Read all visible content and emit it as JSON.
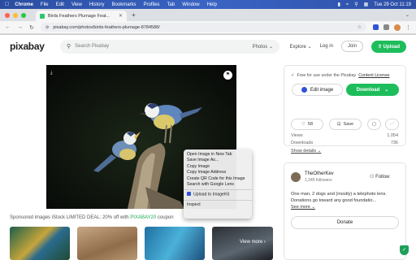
{
  "menubar": {
    "app": "Chrome",
    "items": [
      "File",
      "Edit",
      "View",
      "History",
      "Bookmarks",
      "Profiles",
      "Tab",
      "Window",
      "Help"
    ],
    "clock": "Tue 29 Oct  11:19"
  },
  "tab": {
    "title": "Birds Feathers Plumage Feat..."
  },
  "address": {
    "url": "pixabay.com/photos/birds-feathers-plumage-8784588/"
  },
  "header": {
    "logo": "pixabay",
    "search_placeholder": "Search Pixabay",
    "search_filter": "Photos",
    "explore": "Explore",
    "login": "Log in",
    "join": "Join",
    "upload": "Upload"
  },
  "context_menu": {
    "items": [
      "Open Image in New Tab",
      "Save Image As...",
      "Copy Image",
      "Copy Image Address",
      "Create QR Code for this Image",
      "Search with Google Lens"
    ],
    "extension_item": "Upload to ImageKit",
    "inspect": "Inspect"
  },
  "sponsored": {
    "text": "Sponsored images iStock LIMITED DEAL: 20% off with",
    "code": "PIXABAY20",
    "suffix": "coupon"
  },
  "thumbs": {
    "more_label": "View more"
  },
  "panel": {
    "license_prefix": "Free for use under the Pixabay",
    "license_link": "Content License",
    "edit_label": "Edit image",
    "download_label": "Download",
    "likes": "58",
    "save_label": "Save"
  },
  "stats": {
    "views_label": "Views",
    "views_value": "1,054",
    "downloads_label": "Downloads",
    "downloads_value": "736",
    "show_details": "Show details"
  },
  "author": {
    "name": "TheOtherKev",
    "followers": "1,345 followers",
    "follow_label": "Follow",
    "bio": "One man, 2 dogs and (mostly) a telephoto lens. Donations go toward any good foundatio...",
    "see_more": "See more",
    "donate_label": "Donate"
  },
  "colors": {
    "accent": "#1ebd5c",
    "menubar": "#2a4da1"
  }
}
